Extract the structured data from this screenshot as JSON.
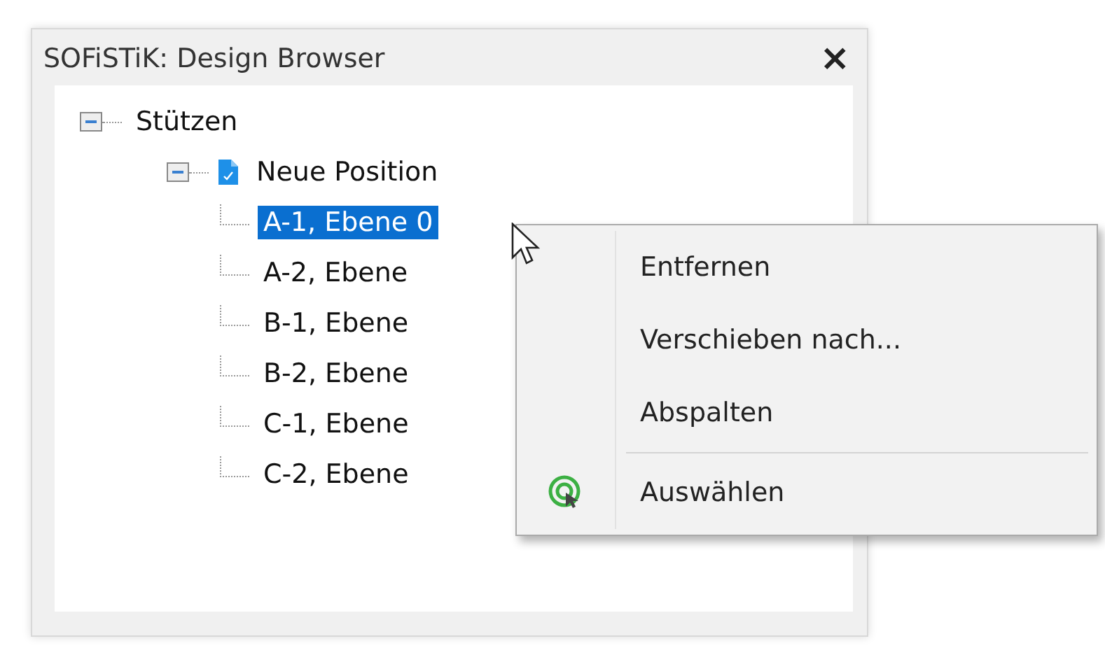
{
  "window": {
    "title": "SOFiSTiK: Design Browser",
    "close": "×"
  },
  "tree": [
    {
      "label": "Stützen",
      "kind": "group",
      "expanded": true,
      "selected": false,
      "children": [
        {
          "label": "Neue Position",
          "kind": "position",
          "expanded": true,
          "selected": false,
          "children": [
            {
              "label": "A-1, Ebene 0",
              "kind": "element",
              "selected": true
            },
            {
              "label": "A-2, Ebene",
              "kind": "element",
              "selected": false
            },
            {
              "label": "B-1, Ebene",
              "kind": "element",
              "selected": false
            },
            {
              "label": "B-2, Ebene",
              "kind": "element",
              "selected": false
            },
            {
              "label": "C-1, Ebene",
              "kind": "element",
              "selected": false
            },
            {
              "label": "C-2, Ebene",
              "kind": "element",
              "selected": false
            }
          ]
        }
      ]
    }
  ],
  "context_menu": [
    {
      "kind": "item",
      "label": "Entfernen"
    },
    {
      "kind": "item",
      "label": "Verschieben nach..."
    },
    {
      "kind": "item",
      "label": "Abspalten"
    },
    {
      "kind": "separator"
    },
    {
      "kind": "icon-item",
      "label": "Auswählen"
    }
  ]
}
